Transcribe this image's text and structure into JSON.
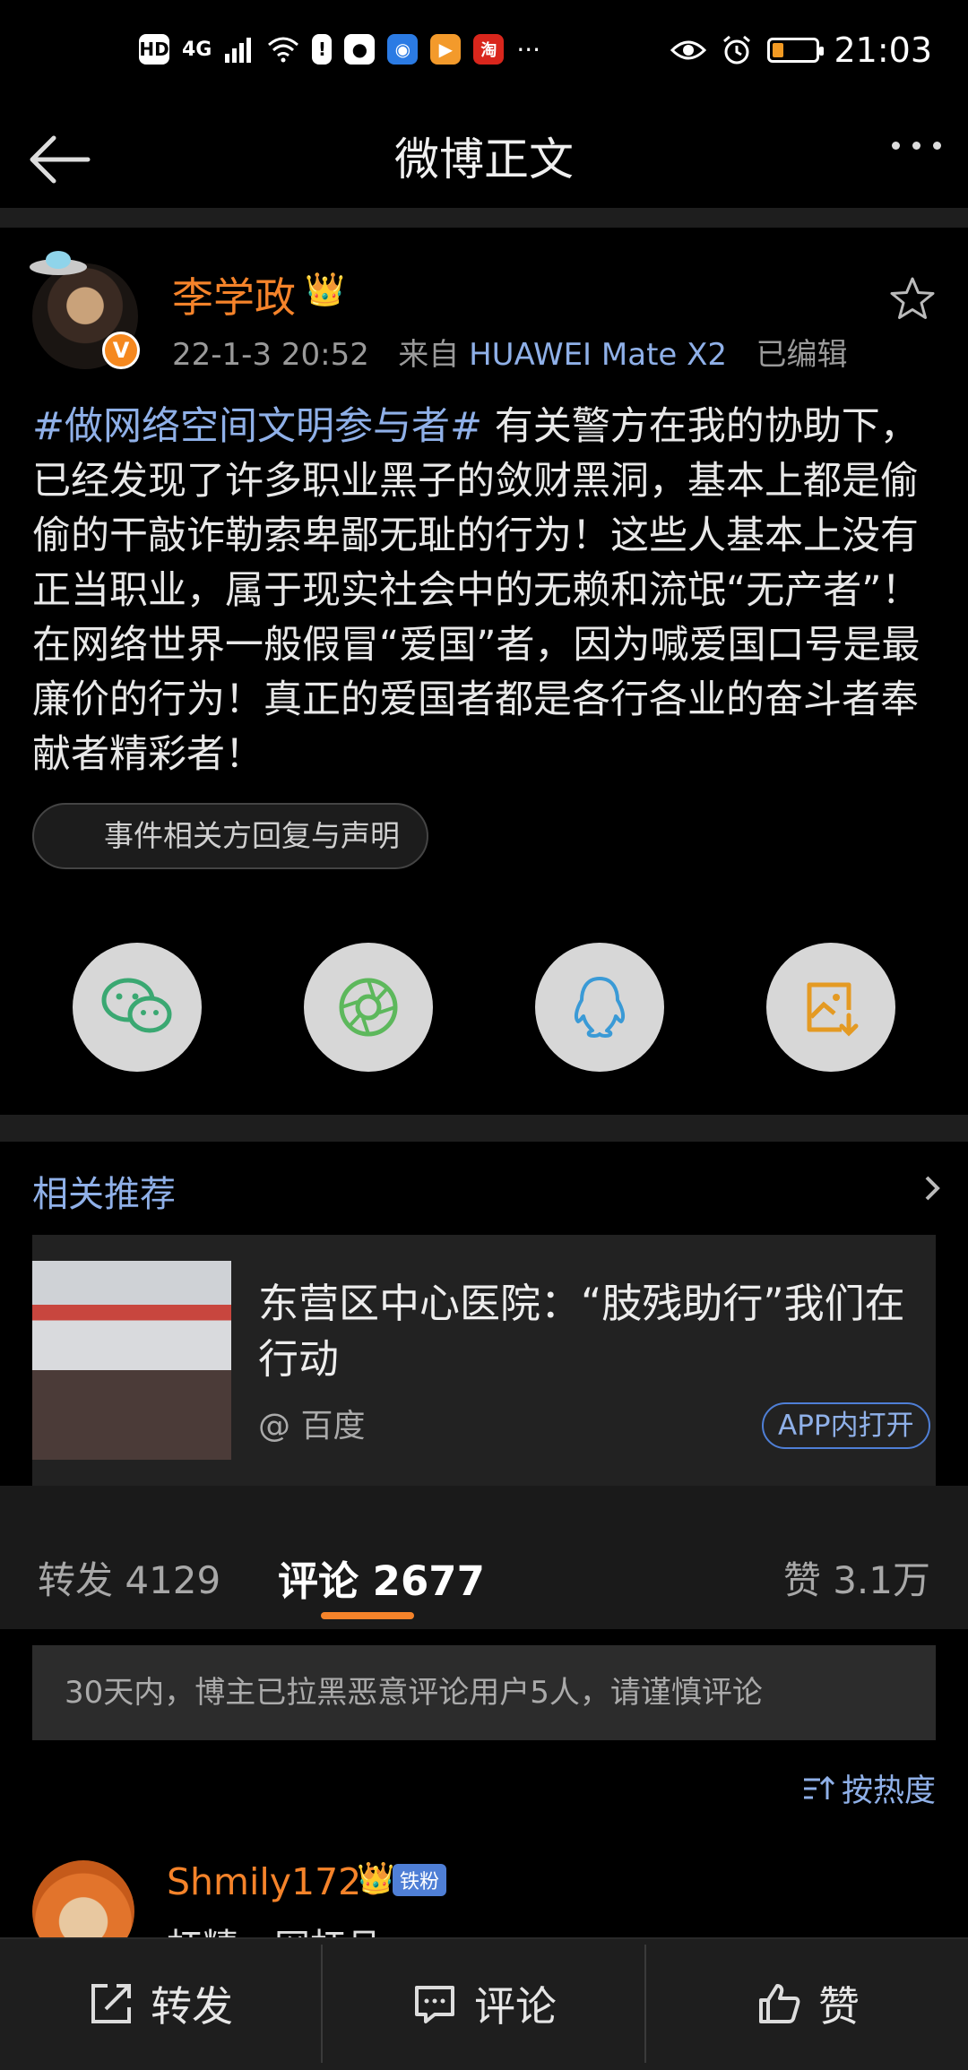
{
  "status_bar": {
    "hd": "HD",
    "network": "4G",
    "more": "···",
    "time": "21:03",
    "battery_level": 0.25
  },
  "header": {
    "title": "微博正文"
  },
  "post": {
    "username": "李学政",
    "verified_badge": "V",
    "date": "22-1-3 20:52",
    "source_prefix": "来自",
    "source_device": "HUAWEI Mate X2",
    "edited": "已编辑",
    "hashtag": "#做网络空间文明参与者#",
    "text": " 有关警方在我的协助下，已经发现了许多职业黑子的敛财黑洞，基本上都是偷偷的干敲诈勒索卑鄙无耻的行为！这些人基本上没有正当职业，属于现实社会中的无赖和流氓“无产者”！在网络世界一般假冒“爱国”者，因为喊爱国口号是最廉价的行为！真正的爱国者都是各行各业的奋斗者奉献者精彩者！",
    "event_label": "事件相关方回复与声明"
  },
  "share_icons": [
    "wechat-icon",
    "moments-icon",
    "qq-icon",
    "save-image-icon"
  ],
  "related": {
    "title": "相关推荐",
    "card_title": "东营区中心医院：“肢残助行”我们在行动",
    "card_source": "@ 百度",
    "app_button": "APP内打开"
  },
  "tabs": {
    "repost": "转发 4129",
    "comment": "评论 2677",
    "like": "赞 3.1万"
  },
  "notice": "30天内，博主已拉黑恶意评论用户5人，请谨慎评论",
  "sort_label": "按热度",
  "comment_preview": {
    "username": "Shmily1720",
    "fan_badge": "铁粉",
    "text": "杠精，网杠且"
  },
  "bottom_bar": {
    "repost": "转发",
    "comment": "评论",
    "like": "赞"
  },
  "colors": {
    "accent_orange": "#f5832a",
    "link_blue": "#8fb0e8",
    "background": "#000000"
  }
}
